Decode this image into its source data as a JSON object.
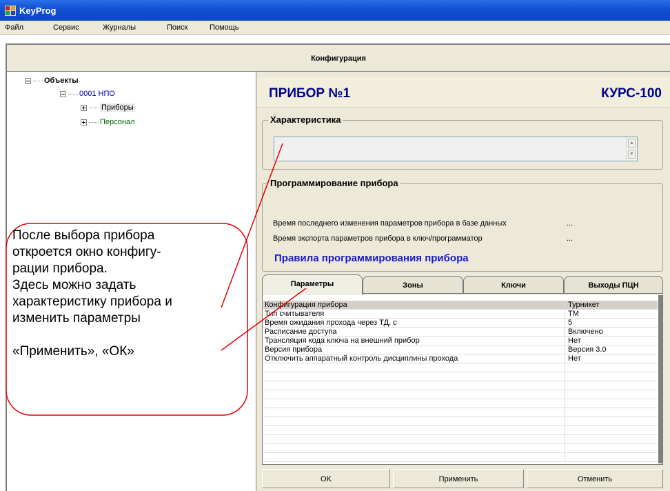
{
  "window": {
    "title": "KeyProg",
    "icon": "keyprog-app-icon"
  },
  "menu": {
    "items": [
      "Файл",
      "Сервис",
      "Журналы",
      "Поиск",
      "Помощь"
    ]
  },
  "config_header": "Конфигурация",
  "tree": {
    "root": "Объекты",
    "org": "0001  НПО",
    "children": [
      "Приборы",
      "Персонал"
    ]
  },
  "device": {
    "title": "ПРИБОР №1",
    "model": "КУРС-100"
  },
  "characteristic": {
    "label": "Характеристика",
    "value": ""
  },
  "programming": {
    "label": "Программирование прибора",
    "db_change_label": "Время последнего изменения параметров прибора в базе данных",
    "db_change_value": "...",
    "export_label": "Время экспорта параметров прибора в ключ/программатор",
    "export_value": "...",
    "rules_link": "Правила программирования прибора"
  },
  "tabs": [
    "Параметры",
    "Зоны",
    "Ключи",
    "Выходы  ПЦН"
  ],
  "active_tab": "Параметры",
  "params": [
    {
      "name": "Конфигурация прибора",
      "value": "Турникет"
    },
    {
      "name": "Тип считывателя",
      "value": "TM"
    },
    {
      "name": "Время ожидания прохода через ТД, с",
      "value": "5"
    },
    {
      "name": "Расписание доступа",
      "value": "Включено"
    },
    {
      "name": "Трансляция кода ключа на внешний прибор",
      "value": "Нет"
    },
    {
      "name": "Версия прибора",
      "value": "Версия 3.0"
    },
    {
      "name": "Отключить аппаратный контроль дисциплины прохода",
      "value": "Нет"
    }
  ],
  "empty_rows": 11,
  "buttons": {
    "ok": "OK",
    "apply": "Применить",
    "cancel": "Отменить"
  },
  "callout": {
    "lines": [
      "После выбора прибора",
      "откроется окно конфигу-",
      "рации прибора.",
      "Здесь можно задать",
      "характеристику прибора и",
      "изменить параметры"
    ],
    "note": "«Применить», «ОК»"
  },
  "colors": {
    "title_blue": "#00008b",
    "link_blue": "#1a1acd",
    "annotation_red": "#e00000"
  }
}
